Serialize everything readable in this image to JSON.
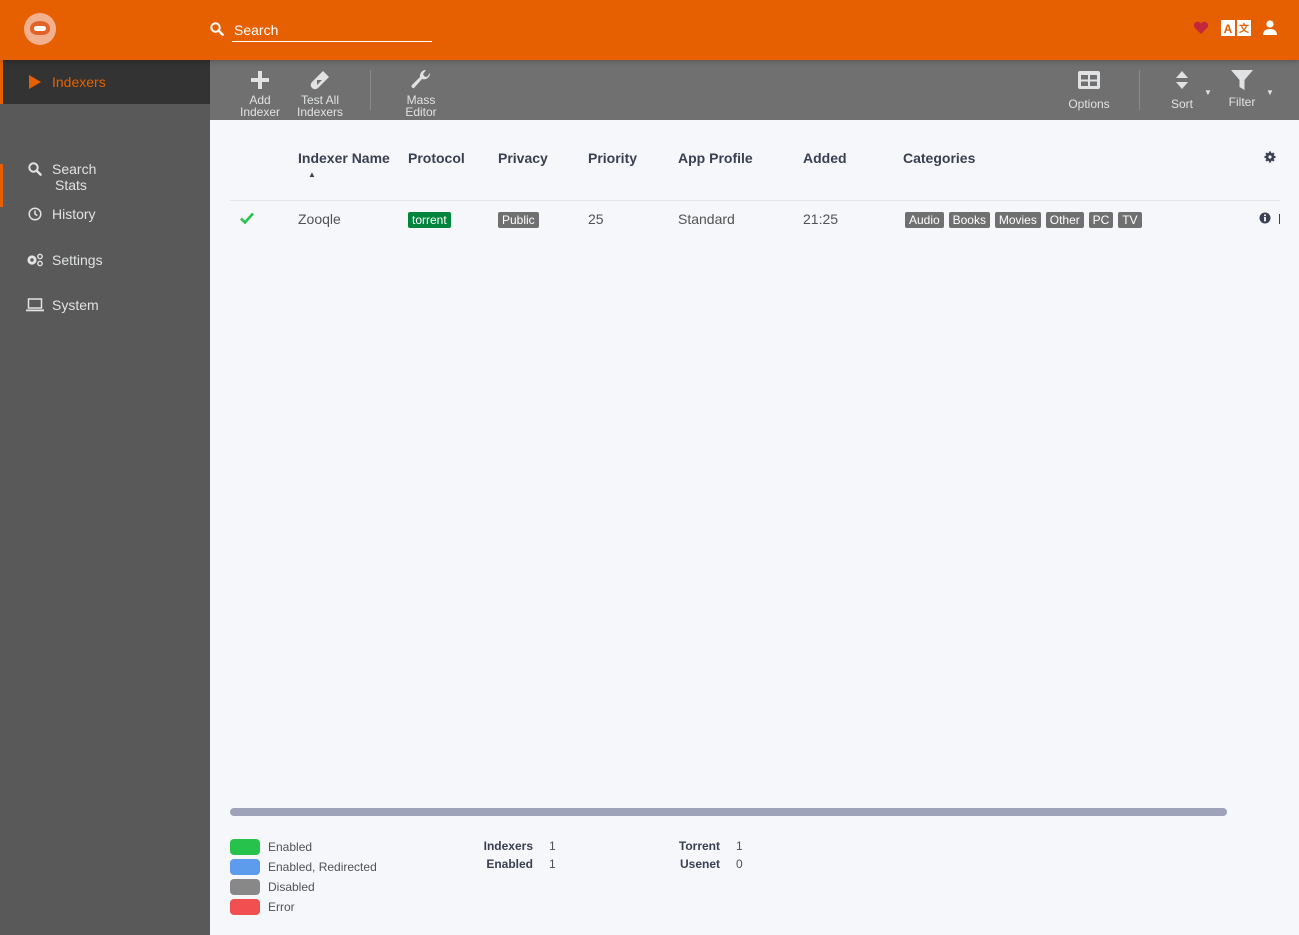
{
  "header": {
    "search_placeholder": "Search",
    "icons": [
      "heart-icon",
      "translate-icon",
      "user-icon"
    ],
    "heart_color": "#c4273c",
    "accent": "#e66001"
  },
  "sidebar": {
    "items": [
      {
        "label": "Indexers",
        "icon": "play-icon",
        "active": true
      },
      {
        "label": "Stats",
        "sub": true
      },
      {
        "label": "Search",
        "icon": "search-icon"
      },
      {
        "label": "History",
        "icon": "clock-icon"
      },
      {
        "label": "Settings",
        "icon": "cogs-icon"
      },
      {
        "label": "System",
        "icon": "laptop-icon"
      }
    ]
  },
  "toolbar": {
    "add_indexer": [
      "Add",
      "Indexer"
    ],
    "test_all": [
      "Test All",
      "Indexers"
    ],
    "mass_editor": [
      "Mass",
      "Editor"
    ],
    "options": "Options",
    "sort": "Sort",
    "filter": "Filter"
  },
  "table": {
    "columns": [
      "Indexer Name",
      "Protocol",
      "Privacy",
      "Priority",
      "App Profile",
      "Added",
      "Categories"
    ],
    "sort_column": "Indexer Name",
    "sort_direction": "ascending",
    "rows": [
      {
        "status": "enabled",
        "name": "Zooqle",
        "protocol": "torrent",
        "privacy": "Public",
        "priority": "25",
        "app_profile": "Standard",
        "added": "21:25",
        "categories": [
          "Audio",
          "Books",
          "Movies",
          "Other",
          "PC",
          "TV"
        ]
      }
    ]
  },
  "legend": [
    {
      "label": "Enabled",
      "color": "#27c24c"
    },
    {
      "label": "Enabled, Redirected",
      "color": "#5d9cec"
    },
    {
      "label": "Disabled",
      "color": "#888888"
    },
    {
      "label": "Error",
      "color": "#f05050"
    }
  ],
  "stats": {
    "indexers_label": "Indexers",
    "indexers": "1",
    "enabled_label": "Enabled",
    "enabled": "1",
    "torrent_label": "Torrent",
    "torrent": "1",
    "usenet_label": "Usenet",
    "usenet": "0"
  }
}
